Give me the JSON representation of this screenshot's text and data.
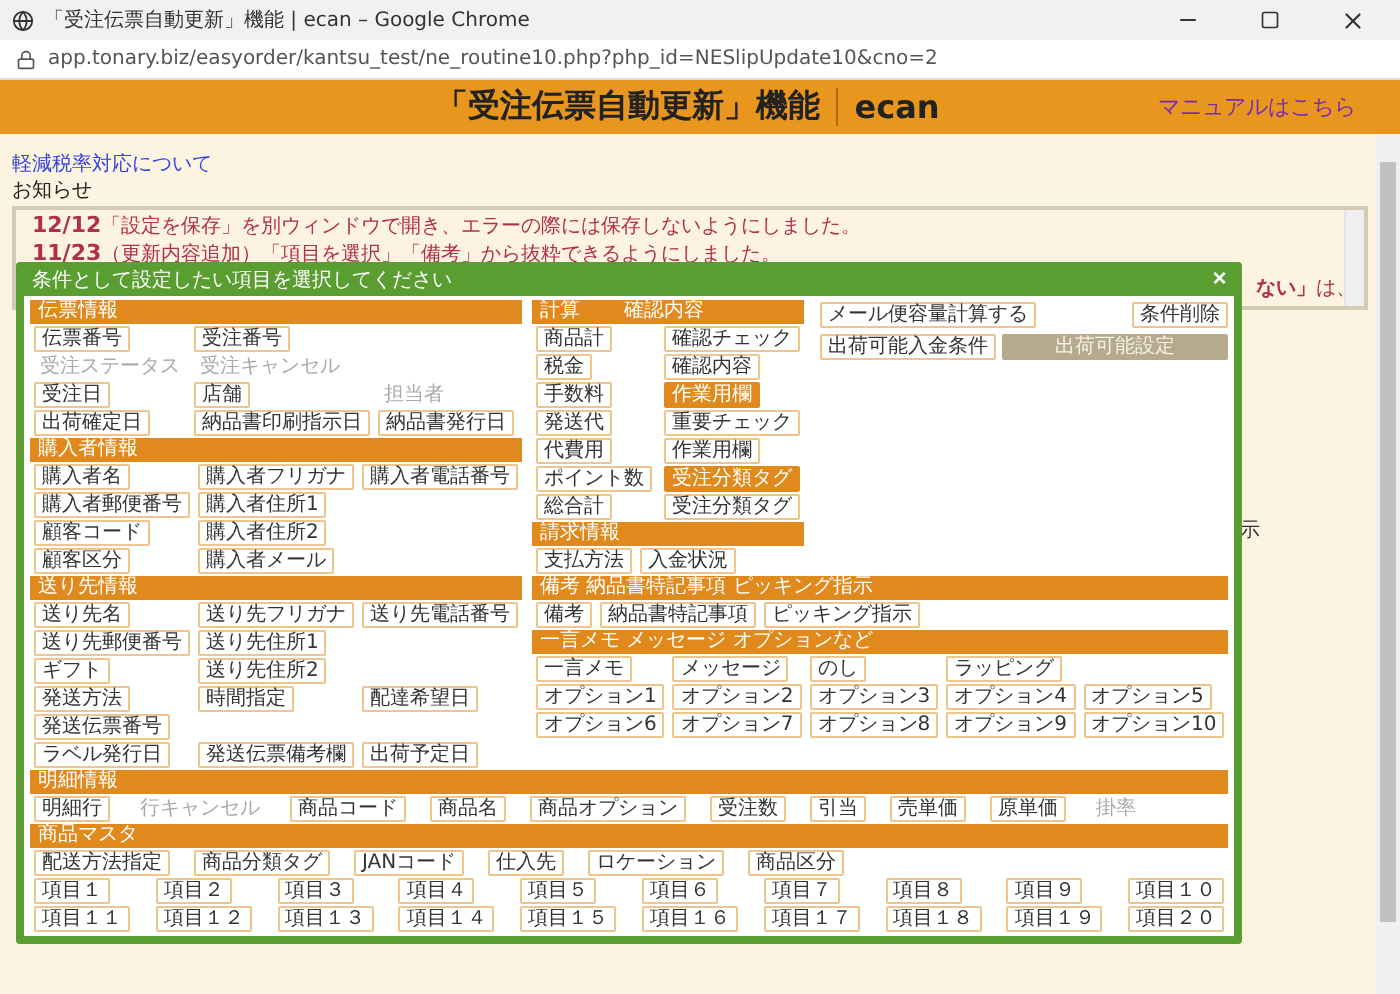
{
  "window": {
    "title": "「受注伝票自動更新」機能 | ecan – Google Chrome",
    "url": "app.tonary.biz/easyorder/kantsu_test/ne_routine10.php?php_id=NESlipUpdate10&cno=2"
  },
  "header": {
    "title": "「受注伝票自動更新」機能",
    "brand": "ecan",
    "manual_link": "マニュアルはこちら"
  },
  "tax_link": "軽減税率対応について",
  "notice": {
    "heading": "お知らせ",
    "lines": [
      {
        "date": "12/12",
        "text": "「設定を保存」を別ウィンドウで開き、エラーの際には保存しないようにしました。"
      },
      {
        "date": "11/23",
        "text": "（更新内容追加）「項目を選択」「備考」から抜粋できるようにしました。"
      }
    ],
    "tail": "**ない」**は、"
  },
  "background_text": "示",
  "modal": {
    "title": "条件として設定したい項目を選択してください",
    "close": "×",
    "left_sections": [
      {
        "title": "伝票情報",
        "grid": [
          [
            {
              "label": "伝票番号",
              "kind": "button"
            },
            {
              "label": "受注番号",
              "kind": "button"
            }
          ],
          [
            {
              "label": "受注ステータス",
              "kind": "text"
            },
            {
              "label": "受注キャンセル",
              "kind": "text"
            }
          ],
          [
            {
              "label": "受注日",
              "kind": "button"
            },
            {
              "label": "店舗",
              "kind": "button"
            },
            {
              "label": "担当者",
              "kind": "text"
            }
          ],
          [
            {
              "label": "出荷確定日",
              "kind": "button"
            },
            {
              "label": "納品書印刷指示日",
              "kind": "button"
            },
            {
              "label": "納品書発行日",
              "kind": "button"
            }
          ]
        ]
      },
      {
        "title": "購入者情報",
        "grid": [
          [
            {
              "label": "購入者名",
              "kind": "button"
            },
            {
              "label": "購入者フリガナ",
              "kind": "button"
            },
            {
              "label": "購入者電話番号",
              "kind": "button"
            }
          ],
          [
            {
              "label": "購入者郵便番号",
              "kind": "button"
            },
            {
              "label": "購入者住所1",
              "kind": "button"
            }
          ],
          [
            {
              "label": "顧客コード",
              "kind": "button"
            },
            {
              "label": "購入者住所2",
              "kind": "button"
            }
          ],
          [
            {
              "label": "顧客区分",
              "kind": "button"
            },
            {
              "label": "購入者メール",
              "kind": "button"
            }
          ]
        ]
      },
      {
        "title": "送り先情報",
        "grid": [
          [
            {
              "label": "送り先名",
              "kind": "button"
            },
            {
              "label": "送り先フリガナ",
              "kind": "button"
            },
            {
              "label": "送り先電話番号",
              "kind": "button"
            }
          ],
          [
            {
              "label": "送り先郵便番号",
              "kind": "button"
            },
            {
              "label": "送り先住所1",
              "kind": "button"
            }
          ],
          [
            {
              "label": "ギフト",
              "kind": "button"
            },
            {
              "label": "送り先住所2",
              "kind": "button"
            }
          ],
          [
            {
              "label": "発送方法",
              "kind": "button"
            },
            {
              "label": "時間指定",
              "kind": "button"
            },
            {
              "label": "配達希望日",
              "kind": "button"
            }
          ],
          [
            {
              "label": "発送伝票番号",
              "kind": "button"
            }
          ],
          [
            {
              "label": "ラベル発行日",
              "kind": "button"
            },
            {
              "label": "発送伝票備考欄",
              "kind": "button"
            },
            {
              "label": "出荷予定日",
              "kind": "button"
            }
          ]
        ]
      }
    ],
    "calc_columns": [
      {
        "title": "計算",
        "items": [
          {
            "label": "商品計",
            "kind": "button"
          },
          {
            "label": "税金",
            "kind": "button"
          },
          {
            "label": "手数料",
            "kind": "button"
          },
          {
            "label": "発送代",
            "kind": "button"
          },
          {
            "label": "代費用",
            "kind": "button"
          },
          {
            "label": "ポイント数",
            "kind": "button"
          },
          {
            "label": "総合計",
            "kind": "button"
          }
        ]
      },
      {
        "title": "確認内容",
        "items": [
          {
            "label": "確認チェック",
            "kind": "button"
          },
          {
            "label": "確認内容",
            "kind": "button"
          },
          {
            "label": "作業用欄",
            "kind": "tag"
          },
          {
            "label": "重要チェック",
            "kind": "button"
          },
          {
            "label": "作業用欄",
            "kind": "button"
          },
          {
            "label": "受注分類タグ",
            "kind": "tag"
          },
          {
            "label": "受注分類タグ",
            "kind": "button"
          }
        ]
      }
    ],
    "billing": {
      "title": "請求情報",
      "items": [
        {
          "label": "支払方法",
          "kind": "button"
        },
        {
          "label": "入金状況",
          "kind": "button"
        }
      ]
    },
    "actions": [
      [
        {
          "label": "メール便容量計算する",
          "kind": "button"
        },
        {
          "label": "条件削除",
          "kind": "button"
        }
      ],
      [
        {
          "label": "出荷可能入金条件",
          "kind": "button"
        },
        {
          "label": "出荷可能設定",
          "kind": "disabled-button"
        }
      ]
    ],
    "right_sections": [
      {
        "title": "備考 納品書特記事項 ピッキング指示",
        "rows": [
          [
            {
              "label": "備考",
              "kind": "button"
            },
            {
              "label": "納品書特記事項",
              "kind": "button"
            },
            {
              "label": "ピッキング指示",
              "kind": "button"
            }
          ]
        ]
      },
      {
        "title": "一言メモ メッセージ オプションなど",
        "grid": [
          [
            {
              "label": "一言メモ",
              "kind": "button"
            },
            {
              "label": "メッセージ",
              "kind": "button"
            },
            {
              "label": "のし",
              "kind": "button"
            },
            {
              "label": "ラッピング",
              "kind": "button"
            }
          ],
          [
            {
              "label": "オプション1",
              "kind": "button"
            },
            {
              "label": "オプション2",
              "kind": "button"
            },
            {
              "label": "オプション3",
              "kind": "button"
            },
            {
              "label": "オプション4",
              "kind": "button"
            },
            {
              "label": "オプション5",
              "kind": "button"
            }
          ],
          [
            {
              "label": "オプション6",
              "kind": "button"
            },
            {
              "label": "オプション7",
              "kind": "button"
            },
            {
              "label": "オプション8",
              "kind": "button"
            },
            {
              "label": "オプション9",
              "kind": "button"
            },
            {
              "label": "オプション10",
              "kind": "button"
            }
          ]
        ]
      }
    ],
    "full_sections": [
      {
        "title": "明細情報",
        "rows": [
          [
            {
              "label": "明細行",
              "kind": "button"
            },
            {
              "label": "行キャンセル",
              "kind": "text"
            },
            {
              "label": "商品コード",
              "kind": "button"
            },
            {
              "label": "商品名",
              "kind": "button"
            },
            {
              "label": "商品オプション",
              "kind": "button"
            },
            {
              "label": "受注数",
              "kind": "button"
            },
            {
              "label": "引当",
              "kind": "button"
            },
            {
              "label": "売単価",
              "kind": "button"
            },
            {
              "label": "原単価",
              "kind": "button"
            },
            {
              "label": "掛率",
              "kind": "text"
            }
          ]
        ]
      },
      {
        "title": "商品マスタ",
        "rows": [
          [
            {
              "label": "配送方法指定",
              "kind": "button"
            },
            {
              "label": "商品分類タグ",
              "kind": "button"
            },
            {
              "label": "JANコード",
              "kind": "button"
            },
            {
              "label": "仕入先",
              "kind": "button"
            },
            {
              "label": "ロケーション",
              "kind": "button"
            },
            {
              "label": "商品区分",
              "kind": "button"
            }
          ]
        ],
        "grid": [
          [
            {
              "label": "項目１",
              "kind": "button"
            },
            {
              "label": "項目２",
              "kind": "button"
            },
            {
              "label": "項目３",
              "kind": "button"
            },
            {
              "label": "項目４",
              "kind": "button"
            },
            {
              "label": "項目５",
              "kind": "button"
            },
            {
              "label": "項目６",
              "kind": "button"
            },
            {
              "label": "項目７",
              "kind": "button"
            },
            {
              "label": "項目８",
              "kind": "button"
            },
            {
              "label": "項目９",
              "kind": "button"
            },
            {
              "label": "項目１０",
              "kind": "button"
            }
          ],
          [
            {
              "label": "項目１１",
              "kind": "button"
            },
            {
              "label": "項目１２",
              "kind": "button"
            },
            {
              "label": "項目１３",
              "kind": "button"
            },
            {
              "label": "項目１４",
              "kind": "button"
            },
            {
              "label": "項目１５",
              "kind": "button"
            },
            {
              "label": "項目１６",
              "kind": "button"
            },
            {
              "label": "項目１７",
              "kind": "button"
            },
            {
              "label": "項目１８",
              "kind": "button"
            },
            {
              "label": "項目１９",
              "kind": "button"
            },
            {
              "label": "項目２０",
              "kind": "button"
            }
          ]
        ]
      }
    ]
  }
}
